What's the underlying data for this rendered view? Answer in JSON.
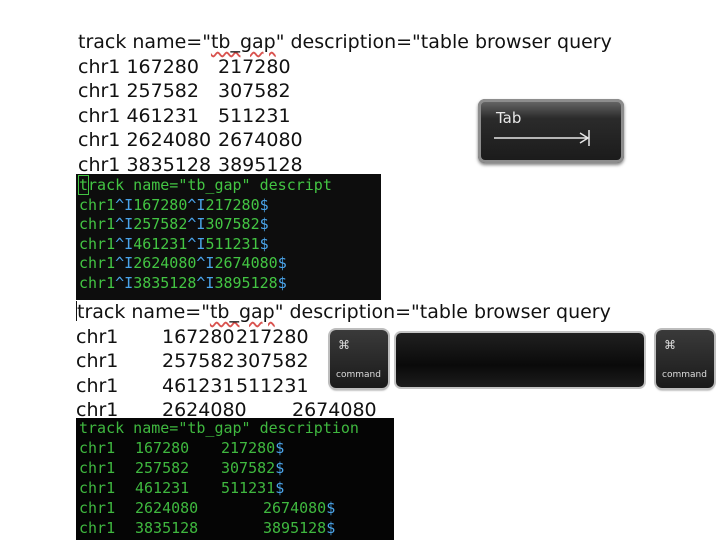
{
  "block1": {
    "header": {
      "part1": "track name=\"",
      "name_value": "tb_gap",
      "part2": "\" description=\"table browser query"
    },
    "rows": [
      {
        "chr": "chr1",
        "start": "167280",
        "end": "217280"
      },
      {
        "chr": "chr1",
        "start": "257582",
        "end": "307582"
      },
      {
        "chr": "chr1",
        "start": "461231",
        "end": "511231"
      },
      {
        "chr": "chr1",
        "start": "2624080",
        "end": "2674080"
      },
      {
        "chr": "chr1",
        "start": "3835128",
        "end": "3895128"
      }
    ]
  },
  "tab_key": {
    "label": "Tab"
  },
  "block2": {
    "header": {
      "cursor_char": "t",
      "rest": "rack name=\"tb_gap\" descript"
    },
    "tab_marker": "^I",
    "eol": "$",
    "rows": [
      {
        "chr": "chr1",
        "start": "167280",
        "end": "217280"
      },
      {
        "chr": "chr1",
        "start": "257582",
        "end": "307582"
      },
      {
        "chr": "chr1",
        "start": "461231",
        "end": "511231"
      },
      {
        "chr": "chr1",
        "start": "2624080",
        "end": "2674080"
      },
      {
        "chr": "chr1",
        "start": "3835128",
        "end": "3895128"
      }
    ]
  },
  "block3": {
    "header": {
      "part1": "track name=\"",
      "name_value": "tb_gap",
      "part2": "\" description=\"table browser query"
    },
    "rows": [
      {
        "chr": "chr1",
        "start": "167280",
        "end": "217280"
      },
      {
        "chr": "chr1",
        "start": "257582",
        "end": "307582"
      },
      {
        "chr": "chr1",
        "start": "461231",
        "end": "511231"
      },
      {
        "chr": "chr1",
        "start": "2624080",
        "end": "2674080"
      }
    ]
  },
  "keyboard": {
    "cmd_symbol": "⌘",
    "cmd_label": "command"
  },
  "block4": {
    "header": "track name=\"tb_gap\" description",
    "eol": "$",
    "rows": [
      {
        "chr": "chr1",
        "start": "167280",
        "end": "217280"
      },
      {
        "chr": "chr1",
        "start": "257582",
        "end": "307582"
      },
      {
        "chr": "chr1",
        "start": "461231",
        "end": "511231"
      },
      {
        "chr": "chr1",
        "start": "2624080",
        "end": "2674080"
      },
      {
        "chr": "chr1",
        "start": "3835128",
        "end": "3895128"
      }
    ]
  }
}
